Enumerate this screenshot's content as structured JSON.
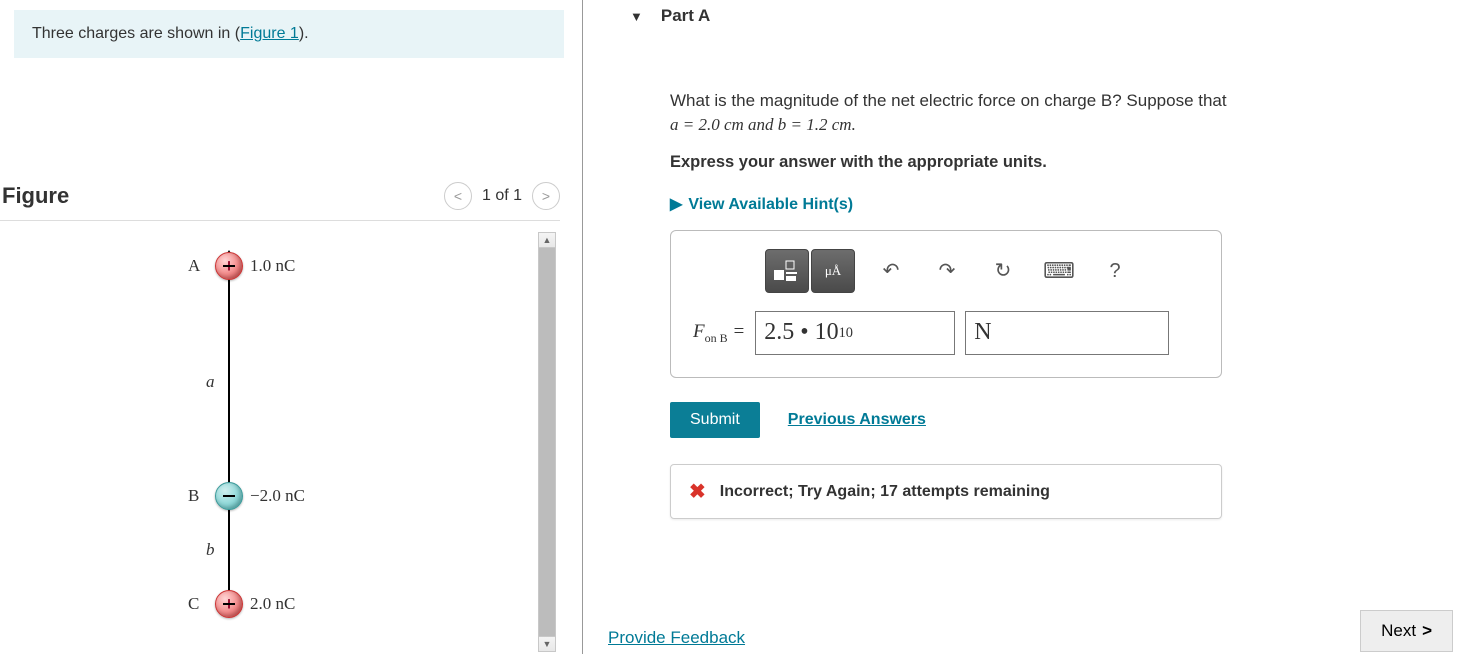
{
  "intro": {
    "text_prefix": "Three charges are shown in (",
    "link_text": "Figure 1",
    "text_suffix": ")."
  },
  "figure": {
    "title": "Figure",
    "pager_text": "1 of 1",
    "charges": {
      "A": {
        "id": "A",
        "sign": "+",
        "value": "1.0 nC"
      },
      "B": {
        "id": "B",
        "sign": "−",
        "value": "−2.0 nC"
      },
      "C": {
        "id": "C",
        "sign": "+",
        "value": "2.0 nC"
      }
    },
    "dims": {
      "a": "a",
      "b": "b"
    }
  },
  "part": {
    "label": "Part A",
    "question_prefix": "What is the magnitude of the net electric force on charge B? Suppose that ",
    "given": "a = 2.0 cm and b = 1.2 cm.",
    "instruction": "Express your answer with the appropriate units.",
    "hints_label": "View Available Hint(s)"
  },
  "answer": {
    "var_label_html": "F_on B =",
    "value_display": "2.5 • 10¹⁰",
    "unit_display": "N",
    "toolbar": {
      "templates": "templates-icon",
      "units": "units-icon",
      "undo": "↶",
      "redo": "↷",
      "reset": "↻",
      "keyboard": "⌨",
      "help": "?"
    }
  },
  "actions": {
    "submit": "Submit",
    "previous": "Previous Answers"
  },
  "feedback": {
    "message": "Incorrect; Try Again; 17 attempts remaining"
  },
  "footer": {
    "provide": "Provide Feedback",
    "next": "Next"
  }
}
